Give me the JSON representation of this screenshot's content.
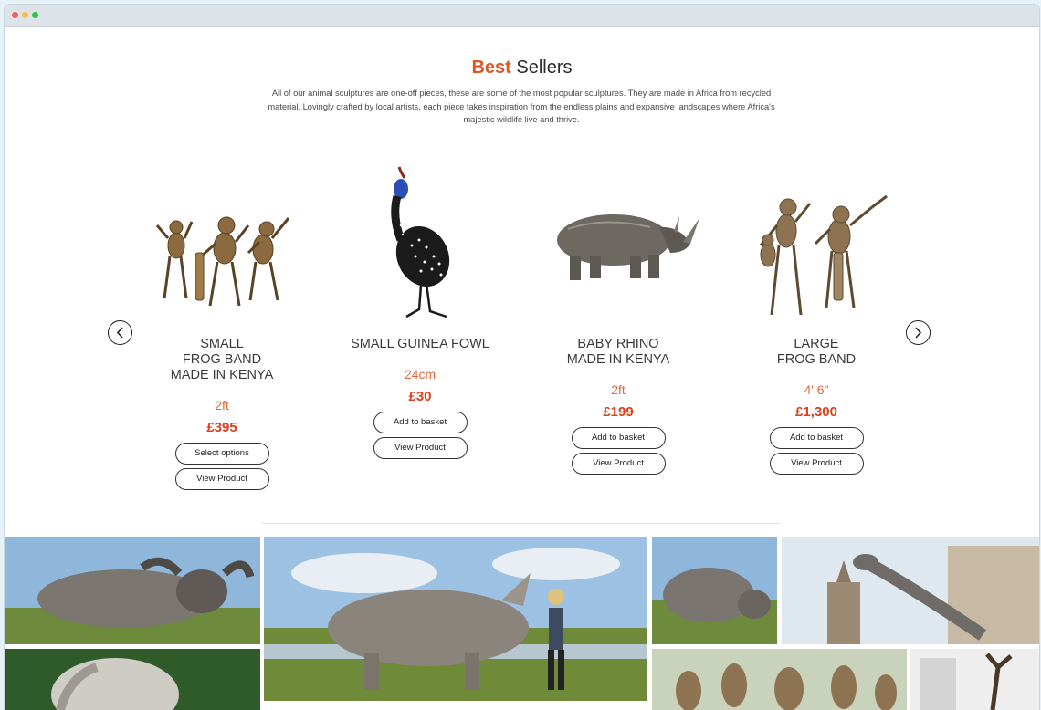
{
  "window": {
    "controls": [
      "close",
      "minimize",
      "maximize"
    ]
  },
  "section": {
    "title_accent": "Best",
    "title_rest": " Sellers",
    "intro": "All of our animal sculptures are one-off pieces, these are some of the most popular sculptures. They are made in Africa from recycled material. Lovingly crafted by local artists, each piece takes inspiration from the endless plains and expansive landscapes where Africa's majestic wildlife live and thrive."
  },
  "carousel": {
    "prev_icon": "chevron-left-icon",
    "next_icon": "chevron-right-icon",
    "products": [
      {
        "name": "Small\nFrog Band\nMade in Kenya",
        "size": "2ft",
        "price": "£395",
        "primary_button": "Select options",
        "secondary_button": "View Product"
      },
      {
        "name": "Small Guinea Fowl",
        "size": "24cm",
        "price": "£30",
        "primary_button": "Add to basket",
        "secondary_button": "View Product"
      },
      {
        "name": "Baby Rhino\nMade in Kenya",
        "size": "2ft",
        "price": "£199",
        "primary_button": "Add to basket",
        "secondary_button": "View Product"
      },
      {
        "name": "Large\nFrog Band",
        "size": "4' 6\"",
        "price": "£1,300",
        "primary_button": "Add to basket",
        "secondary_button": "View Product"
      }
    ]
  },
  "colors": {
    "accent": "#e25424",
    "price": "#d9421c",
    "size": "#e26a3f"
  },
  "gallery": {
    "tiles": [
      "buffalo-sculpture",
      "rhino-sculpture-with-woman",
      "hippo-sculpture",
      "giraffe-sculpture-liverpool",
      "elephant-sculpture",
      "frog-band-sculptures",
      "metal-sculpture-indoor"
    ]
  }
}
